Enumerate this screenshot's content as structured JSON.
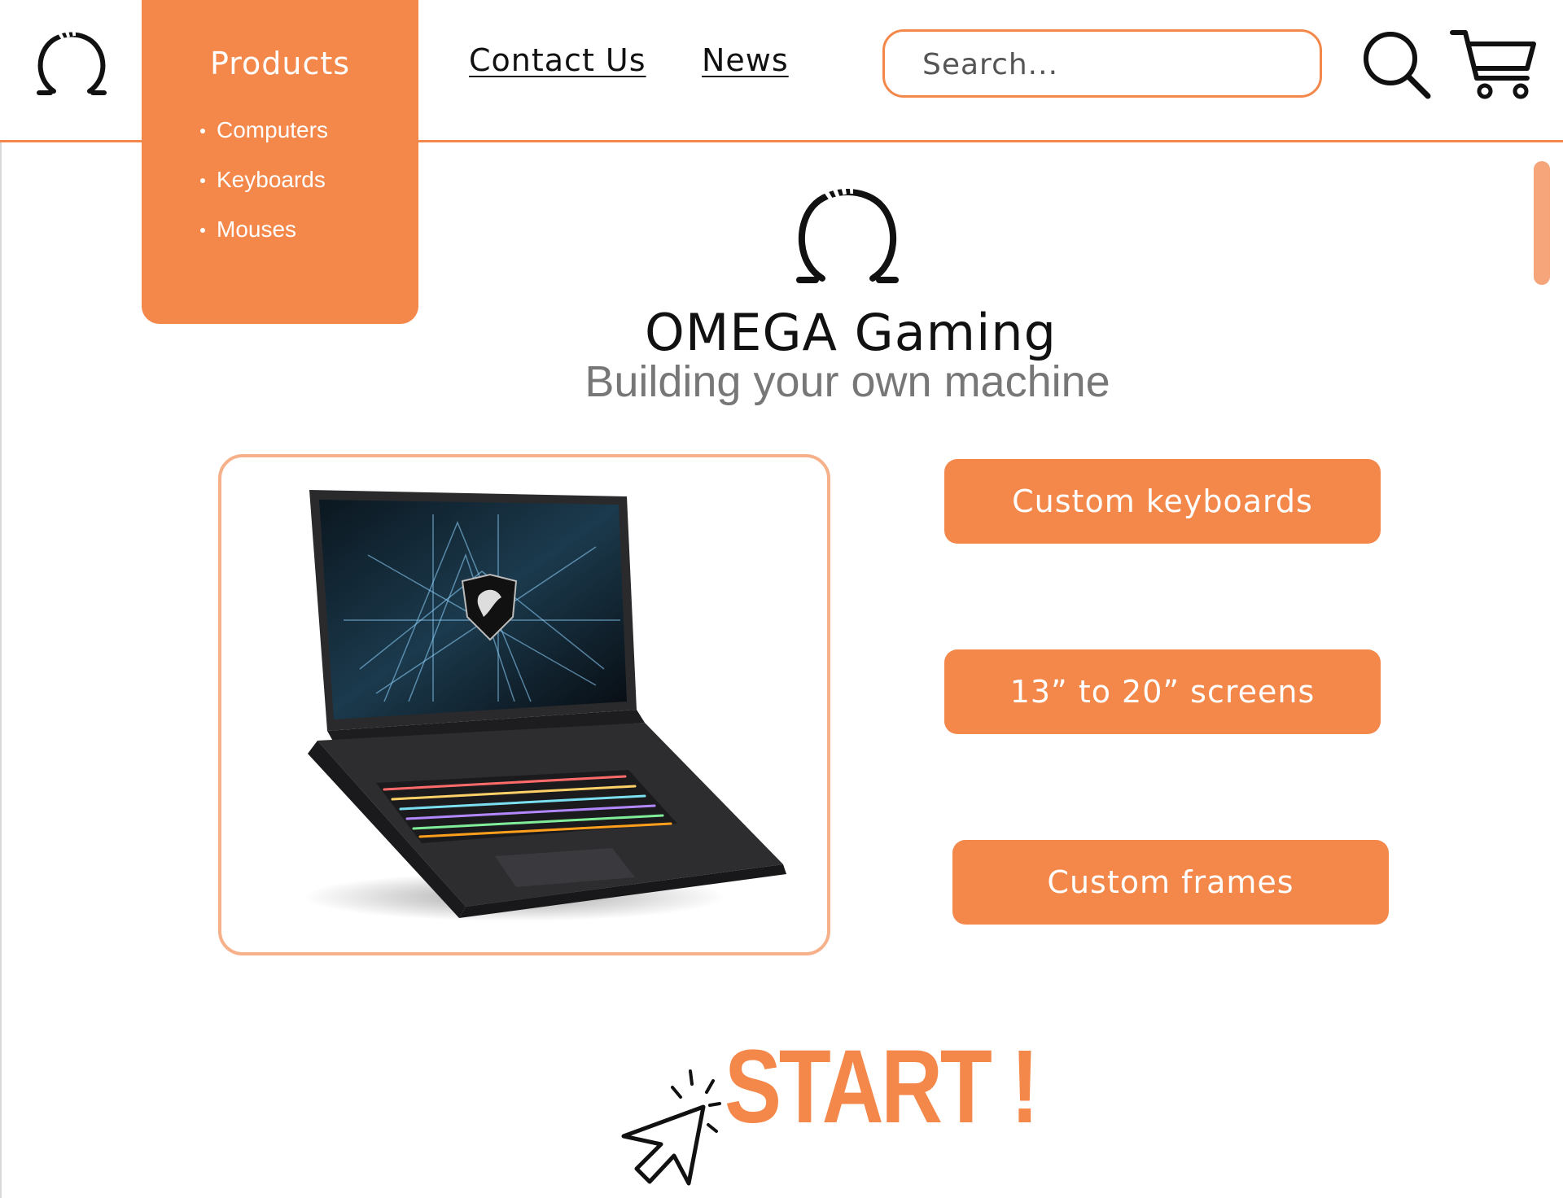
{
  "header": {
    "products": {
      "label": "Products",
      "items": [
        "Computers",
        "Keyboards",
        "Mouses"
      ]
    },
    "nav": {
      "contact": "Contact Us",
      "news": "News"
    },
    "search": {
      "placeholder": "Search..."
    },
    "icons": {
      "logo": "omega-logo-icon",
      "search": "search-icon",
      "cart": "cart-icon"
    }
  },
  "hero": {
    "title": "OMEGA Gaming",
    "subtitle": "Building your own machine"
  },
  "features": [
    {
      "label": "Custom keyboards"
    },
    {
      "label": "13” to 20” screens"
    },
    {
      "label": "Custom frames"
    }
  ],
  "cta": {
    "label": "START !"
  },
  "colors": {
    "accent": "#F4874A",
    "accent_light": "#F6B18A",
    "subtitle": "#777777"
  }
}
